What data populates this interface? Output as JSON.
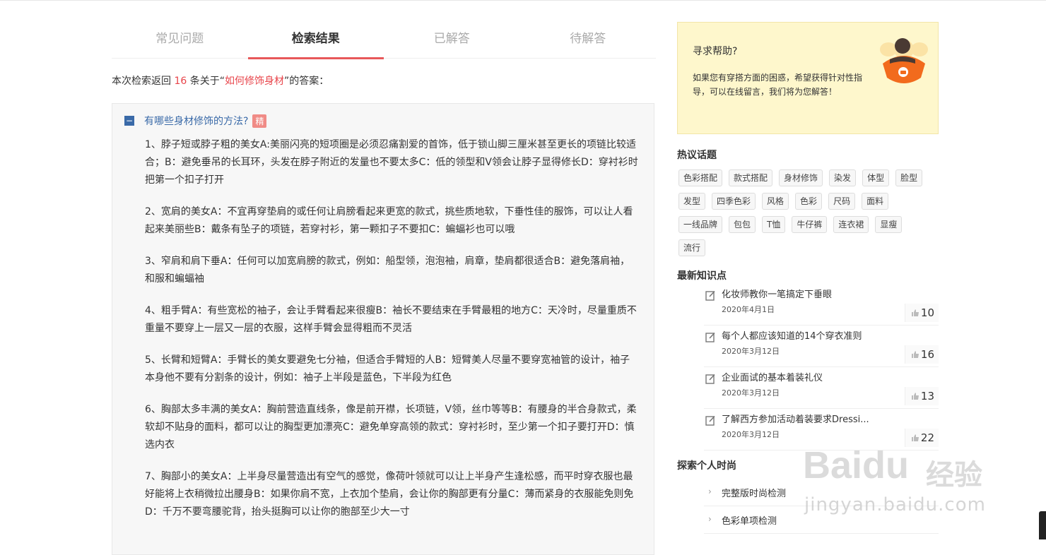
{
  "tabs": [
    {
      "label": "常见问题",
      "active": false
    },
    {
      "label": "检索结果",
      "active": true
    },
    {
      "label": "已解答",
      "active": false
    },
    {
      "label": "待解答",
      "active": false
    }
  ],
  "summary": {
    "prefix": "本次检索返回",
    "count": "16",
    "middle": "条关于“",
    "keyword": "如何修饰身材",
    "suffix": "”的答案："
  },
  "question": {
    "toggle": "−",
    "title": "有哪些身材修饰的方法?",
    "badge": "精",
    "answers": [
      "1、脖子短或脖子粗的美女A:美丽闪亮的短项圈是必须忍痛割爱的首饰，低于锁山脚三厘米甚至更长的项链比较适合；B：避免垂吊的长耳环，头发在脖子附近的发量也不要太多C：低的领型和V领会让脖子显得修长D：穿衬衫时把第一个扣子打开",
      "2、宽肩的美女A：不宜再穿垫肩的或任何让肩膀看起来更宽的款式，挑些质地软，下垂性佳的服饰，可以让人看起来美丽些B：戴条有坠子的项链，若穿衬衫，第一颗扣子不要扣C：蝙蝠衫也可以哦",
      "3、窄肩和肩下垂A：任何可以加宽肩膀的款式，例如：船型领，泡泡袖，肩章，垫肩都很适合B：避免落肩袖，和服和蝙蝠袖",
      "4、粗手臂A：有些宽松的袖子，会让手臂看起来很瘦B：袖长不要结束在手臂最粗的地方C：天冷时，尽量重质不重量不要穿上一层又一层的衣服，这样手臂会显得粗而不灵活",
      "5、长臂和短臂A：手臂长的美女要避免七分袖，但适合手臂短的人B：短臂美人尽量不要穿宽袖管的设计，袖子本身他不要有分割条的设计，例如：袖子上半段是蓝色，下半段为红色",
      "6、胸部太多丰满的美女A：胸前营造直线条，像是前开襟，长项链，V领，丝巾等等B：有腰身的半合身款式，柔软却不贴身的面料，都可以让的胸型更加漂亮C：避免单穿高领的款式：穿衬衫时，至少第一个扣子要打开D：慎选内衣",
      "7、胸部小的美女A：上半身尽量营造出有空气的感觉，像荷叶领就可以让上半身产生逢松感，而平时穿衣服也最好能将上衣稍微拉出腰身B：如果你肩不宽，上衣加个垫肩，会让你的胸部更有分量C：薄而紧身的衣服能免则免D：千万不要弯腰驼背，抬头挺胸可以让你的胞部至少大一寸"
    ]
  },
  "help": {
    "title": "寻求帮助?",
    "text": "如果您有穿搭方面的困惑，希望获得针对性指导，可以在线留言，我们将为您解答！"
  },
  "hot_topics": {
    "title": "热议话题",
    "tags": [
      "色彩搭配",
      "款式搭配",
      "身材修饰",
      "染发",
      "体型",
      "脸型",
      "发型",
      "四季色彩",
      "风格",
      "色彩",
      "尺码",
      "面料",
      "一线品牌",
      "包包",
      "T恤",
      "牛仔裤",
      "连衣裙",
      "显瘦",
      "流行"
    ]
  },
  "knowledge": {
    "title": "最新知识点",
    "items": [
      {
        "title": "化妆师教你一笔搞定下垂眼",
        "date": "2020年4月1日",
        "likes": "10"
      },
      {
        "title": "每个人都应该知道的14个穿衣准则",
        "date": "2020年3月12日",
        "likes": "16"
      },
      {
        "title": "企业面试的基本着装礼仪",
        "date": "2020年3月12日",
        "likes": "13"
      },
      {
        "title": "了解西方参加活动着装要求Dressi...",
        "date": "2020年3月12日",
        "likes": "22"
      }
    ]
  },
  "explore": {
    "title": "探索个人时尚",
    "items": [
      {
        "label": "完整版时尚检测"
      },
      {
        "label": "色彩单项检测"
      }
    ]
  },
  "watermark": {
    "brand": "Baidu",
    "cn": "经验",
    "url": "jingyan.baidu.com"
  },
  "colors": {
    "accent_red": "#e8585a",
    "link_blue": "#3a6aa8",
    "help_bg": "#fef7cc",
    "badge": "#f08b86"
  }
}
